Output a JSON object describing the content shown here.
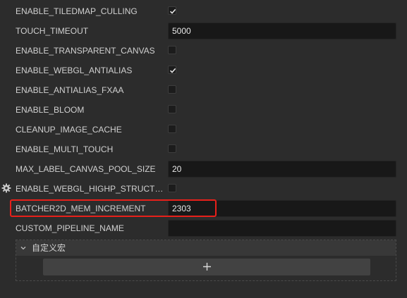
{
  "settings": [
    {
      "label": "ENABLE_TILEDMAP_CULLING",
      "type": "checkbox",
      "checked": true
    },
    {
      "label": "TOUCH_TIMEOUT",
      "type": "input",
      "value": "5000"
    },
    {
      "label": "ENABLE_TRANSPARENT_CANVAS",
      "type": "checkbox",
      "checked": false
    },
    {
      "label": "ENABLE_WEBGL_ANTIALIAS",
      "type": "checkbox",
      "checked": true
    },
    {
      "label": "ENABLE_ANTIALIAS_FXAA",
      "type": "checkbox",
      "checked": false
    },
    {
      "label": "ENABLE_BLOOM",
      "type": "checkbox",
      "checked": false
    },
    {
      "label": "CLEANUP_IMAGE_CACHE",
      "type": "checkbox",
      "checked": false
    },
    {
      "label": "ENABLE_MULTI_TOUCH",
      "type": "checkbox",
      "checked": false
    },
    {
      "label": "MAX_LABEL_CANVAS_POOL_SIZE",
      "type": "input",
      "value": "20"
    },
    {
      "label": "ENABLE_WEBGL_HIGHP_STRUCT_VALUES",
      "type": "checkbox",
      "checked": false,
      "icon": "gear-icon"
    },
    {
      "label": "BATCHER2D_MEM_INCREMENT",
      "type": "input",
      "value": "2303",
      "highlighted": true
    },
    {
      "label": "CUSTOM_PIPELINE_NAME",
      "type": "input",
      "value": ""
    }
  ],
  "custom_macros": {
    "title": "自定义宏",
    "chevron_icon": "chevron-down-icon",
    "add_icon": "plus-icon"
  },
  "colors": {
    "background": "#2c2c2c",
    "highlight": "#e8201a",
    "input_bg": "#181818"
  }
}
